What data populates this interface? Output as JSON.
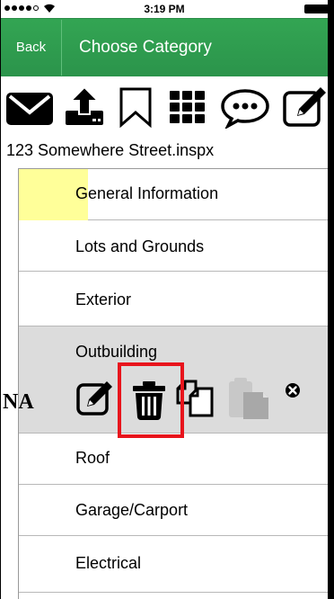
{
  "status_bar": {
    "time": "3:19 PM",
    "signal_dots_filled": 4,
    "signal_dots_total": 5
  },
  "nav": {
    "back_label": "Back",
    "title": "Choose Category"
  },
  "toolbar": {
    "icons": [
      "envelope-icon",
      "upload-icon",
      "bookmark-icon",
      "grid-icon",
      "chat-bubble-icon",
      "edit-icon"
    ]
  },
  "file_name": "123 Somewhere Street.inspx",
  "categories": [
    {
      "label": "General Information",
      "highlighted": true
    },
    {
      "label": "Lots and Grounds"
    },
    {
      "label": "Exterior"
    },
    {
      "label": "Outbuilding",
      "selected": true
    },
    {
      "label": "Roof"
    },
    {
      "label": "Garage/Carport"
    },
    {
      "label": "Electrical"
    }
  ],
  "row_actions": {
    "na_label": "NA",
    "icons": [
      "edit-icon",
      "trash-icon",
      "copy-icon",
      "paste-icon",
      "close-icon"
    ],
    "paste_enabled": false
  },
  "colors": {
    "nav_green": "#2e9b4f",
    "highlight_yellow": "#ffff99",
    "selected_row": "#dcdcdc",
    "callout_red": "#e8141c"
  }
}
